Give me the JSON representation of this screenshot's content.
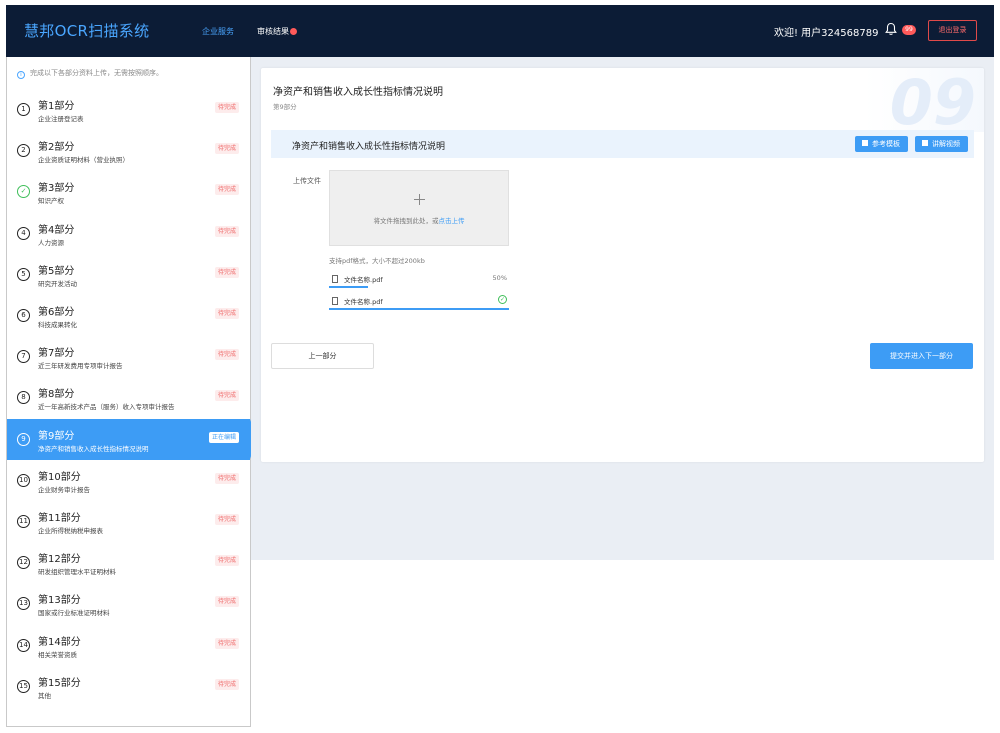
{
  "header": {
    "brand": "慧邦OCR扫描系统",
    "nav": [
      {
        "label": "企业服务",
        "active": true
      },
      {
        "label": "审核结果",
        "active": false
      }
    ],
    "welcome": "欢迎!  用户324568789",
    "notification_count": "99",
    "logout_label": "退出登录"
  },
  "sidebar": {
    "hint": "完成以下各部分资料上传，无需按照顺序。",
    "items": [
      {
        "num": "1",
        "title": "第1部分",
        "sub": "企业注册登记表",
        "status": "待完成",
        "done": false,
        "active": false
      },
      {
        "num": "2",
        "title": "第2部分",
        "sub": "企业资质证明材料（营业执照）",
        "status": "待完成",
        "done": false,
        "active": false
      },
      {
        "num": "✓",
        "title": "第3部分",
        "sub": "知识产权",
        "status": "待完成",
        "done": true,
        "active": false
      },
      {
        "num": "4",
        "title": "第4部分",
        "sub": "人力资源",
        "status": "待完成",
        "done": false,
        "active": false
      },
      {
        "num": "5",
        "title": "第5部分",
        "sub": "研究开发活动",
        "status": "待完成",
        "done": false,
        "active": false
      },
      {
        "num": "6",
        "title": "第6部分",
        "sub": "科技成果转化",
        "status": "待完成",
        "done": false,
        "active": false
      },
      {
        "num": "7",
        "title": "第7部分",
        "sub": "近三年研发费用专项审计报告",
        "status": "待完成",
        "done": false,
        "active": false
      },
      {
        "num": "8",
        "title": "第8部分",
        "sub": "近一年高新技术产品（服务）收入专项审计报告",
        "status": "待完成",
        "done": false,
        "active": false
      },
      {
        "num": "9",
        "title": "第9部分",
        "sub": "净资产和销售收入成长性指标情况说明",
        "status": "正在编辑",
        "done": false,
        "active": true
      },
      {
        "num": "10",
        "title": "第10部分",
        "sub": "企业财务审计报告",
        "status": "待完成",
        "done": false,
        "active": false
      },
      {
        "num": "11",
        "title": "第11部分",
        "sub": "企业所得税纳税申报表",
        "status": "待完成",
        "done": false,
        "active": false
      },
      {
        "num": "12",
        "title": "第12部分",
        "sub": "研发组织管理水平证明材料",
        "status": "待完成",
        "done": false,
        "active": false
      },
      {
        "num": "13",
        "title": "第13部分",
        "sub": "国家或行业标准证明材料",
        "status": "待完成",
        "done": false,
        "active": false
      },
      {
        "num": "14",
        "title": "第14部分",
        "sub": "相关荣誉资质",
        "status": "待完成",
        "done": false,
        "active": false
      },
      {
        "num": "15",
        "title": "第15部分",
        "sub": "其他",
        "status": "待完成",
        "done": false,
        "active": false
      }
    ]
  },
  "main": {
    "title": "净资产和销售收入成长性指标情况说明",
    "subtitle": "第9部分",
    "watermark": "09",
    "section_title": "净资产和销售收入成长性指标情况说明",
    "template_button": "参考模板",
    "video_button": "讲解视频",
    "upload_label": "上传文件",
    "drop_text": "将文件拖拽到此处，或",
    "drop_link": "点击上传",
    "support_text": "支持pdf格式，大小不超过200kb",
    "files": [
      {
        "name": "文件名称.pdf",
        "progress_text": "50%",
        "progress": 0.5,
        "complete": false
      },
      {
        "name": "文件名称.pdf",
        "progress_text": "",
        "progress": 1.0,
        "complete": true
      }
    ],
    "prev_button": "上一部分",
    "next_button": "提交并进入下一部分"
  },
  "colors": {
    "header_bg": "#0c1c36",
    "accent": "#3d9cf5",
    "pending_tag_bg": "#fdecec",
    "pending_tag_text": "#ef6b6b",
    "done": "#3fbf5a"
  }
}
